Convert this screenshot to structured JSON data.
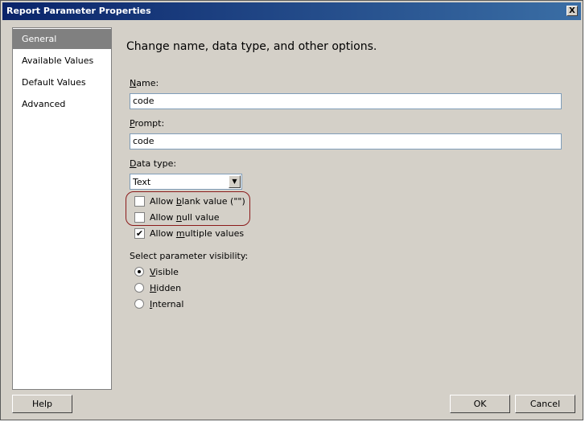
{
  "window": {
    "title": "Report Parameter Properties",
    "close_label": "X"
  },
  "nav": {
    "items": [
      {
        "label": "General",
        "selected": true
      },
      {
        "label": "Available Values",
        "selected": false
      },
      {
        "label": "Default Values",
        "selected": false
      },
      {
        "label": "Advanced",
        "selected": false
      }
    ]
  },
  "main": {
    "heading": "Change name, data type, and other options.",
    "name": {
      "label_key": "N",
      "label_rest": "ame:",
      "value": "code"
    },
    "prompt": {
      "label_key": "P",
      "label_rest": "rompt:",
      "value": "code"
    },
    "data_type": {
      "label_key": "D",
      "label_rest": "ata type:",
      "value": "Text"
    },
    "allow_blank": {
      "pre": "Allow ",
      "key": "b",
      "post": "lank value (\"\")",
      "checked": false
    },
    "allow_null": {
      "pre": "Allow ",
      "key": "n",
      "post": "ull value",
      "checked": false
    },
    "allow_multiple": {
      "pre": "Allow ",
      "key": "m",
      "post": "ultiple values",
      "checked": true
    },
    "visibility_label": "Select parameter visibility:",
    "visibility": [
      {
        "key": "V",
        "rest": "isible",
        "selected": true
      },
      {
        "key": "H",
        "rest": "idden",
        "selected": false
      },
      {
        "key": "I",
        "rest": "nternal",
        "selected": false
      }
    ],
    "highlight_color": "#8b1a1a"
  },
  "buttons": {
    "help": "Help",
    "ok": "OK",
    "cancel": "Cancel"
  },
  "colors": {
    "titlebar_start": "#0a246a",
    "titlebar_end": "#3a6ea5",
    "dialog_bg": "#d4d0c8",
    "nav_selected_bg": "#808080"
  }
}
